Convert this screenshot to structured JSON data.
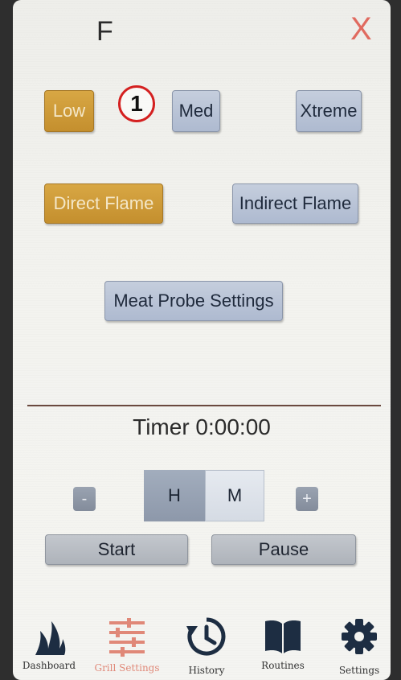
{
  "header": {
    "unit": "F",
    "close": "X"
  },
  "badge": "1",
  "intensity": {
    "low": "Low",
    "med": "Med",
    "xtreme": "Xtreme",
    "selected": "Low"
  },
  "flame": {
    "direct": "Direct Flame",
    "indirect": "Indirect Flame",
    "selected": "Direct Flame"
  },
  "meat_probe": "Meat Probe Settings",
  "timer": {
    "label": "Timer 0:00:00",
    "minus": "-",
    "plus": "+",
    "hours": "H",
    "minutes": "M",
    "start": "Start",
    "pause": "Pause"
  },
  "nav": {
    "items": [
      {
        "label": "Dashboard",
        "icon": "flame-icon"
      },
      {
        "label": "Grill Settings",
        "icon": "sliders-icon",
        "active": true
      },
      {
        "label": "History",
        "icon": "history-icon"
      },
      {
        "label": "Routines",
        "icon": "book-icon"
      },
      {
        "label": "Settings",
        "icon": "gear-icon"
      }
    ]
  },
  "colors": {
    "accent_gold": "#c9952f",
    "close_red": "#e06a5f",
    "active_nav": "#e08878",
    "badge_red": "#d42020"
  }
}
